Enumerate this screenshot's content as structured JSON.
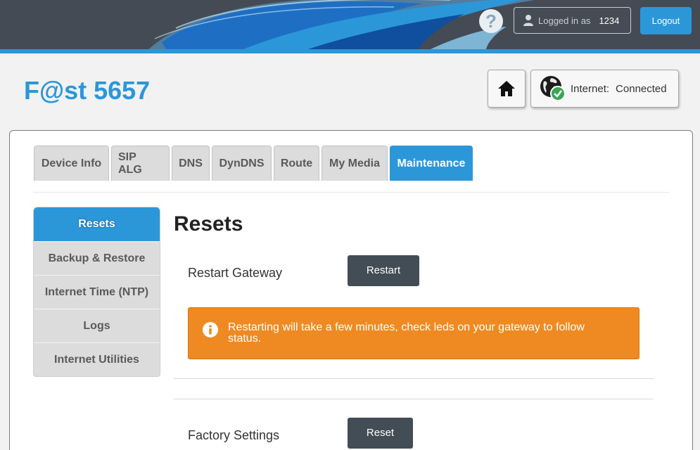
{
  "topbar": {
    "help_label": "?",
    "logged_in_label": "Logged in as",
    "user_id": "1234",
    "logout_label": "Logout"
  },
  "header": {
    "brand": "F@st 5657",
    "internet_label": "Internet:",
    "internet_status": "Connected",
    "home_icon": "home-icon",
    "globe_icon": "globe-check-icon"
  },
  "tabs": [
    {
      "label": "Device Info"
    },
    {
      "label": "SIP ALG"
    },
    {
      "label": "DNS"
    },
    {
      "label": "DynDNS"
    },
    {
      "label": "Route"
    },
    {
      "label": "My Media"
    },
    {
      "label": "Maintenance",
      "active": true
    }
  ],
  "sidebar": {
    "items": [
      {
        "label": "Resets",
        "active": true
      },
      {
        "label": "Backup & Restore"
      },
      {
        "label": "Internet Time (NTP)"
      },
      {
        "label": "Logs"
      },
      {
        "label": "Internet Utilities"
      }
    ]
  },
  "main": {
    "title": "Resets",
    "restart_label": "Restart Gateway",
    "restart_button": "Restart",
    "alert_text": "Restarting will take a few minutes, check leds on your gateway to follow status.",
    "factory_label": "Factory Settings",
    "reset_button": "Reset"
  },
  "colors": {
    "accent": "#2b97d9",
    "topbar": "#444b54",
    "alert": "#ef8a22",
    "button_dark": "#424d56"
  }
}
